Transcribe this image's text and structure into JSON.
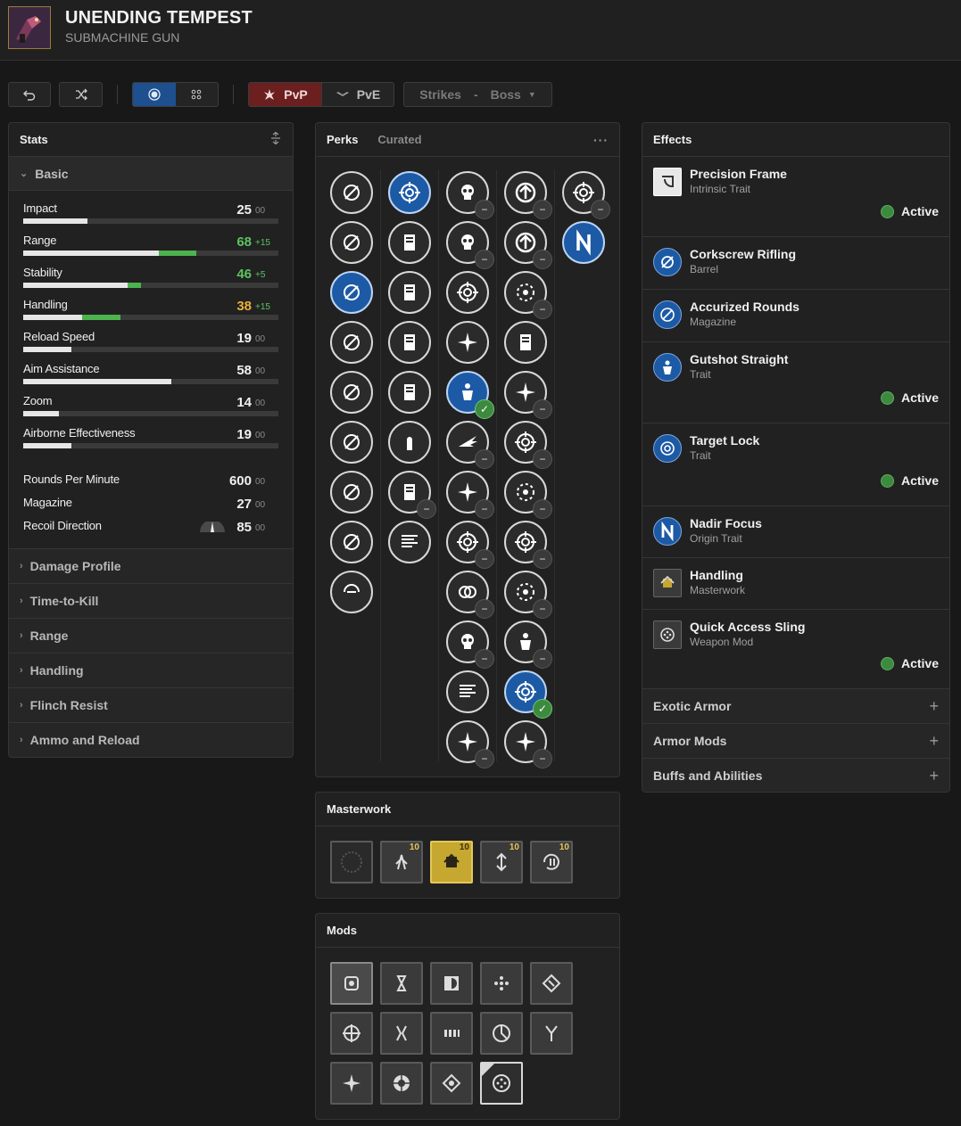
{
  "weapon": {
    "name": "UNENDING TEMPEST",
    "type": "SUBMACHINE GUN"
  },
  "toolbar": {
    "undo_icon": "undo-icon",
    "random_icon": "shuffle-icon",
    "view_single_icon": "circle-dot-icon",
    "view_grid_icon": "grid-dots-icon",
    "pvp_label": "PvP",
    "pve_label": "PvE",
    "activity": "Strikes",
    "activity_sep": "-",
    "difficulty": "Boss"
  },
  "stats": {
    "title": "Stats",
    "basic_label": "Basic",
    "rows": [
      {
        "name": "Impact",
        "value": "25",
        "bonus": "00",
        "base": 25,
        "boost": 0,
        "color": "#f0f0f0"
      },
      {
        "name": "Range",
        "value": "68",
        "bonus": "+15",
        "base": 53,
        "boost": 15,
        "color": "#5cc35f"
      },
      {
        "name": "Stability",
        "value": "46",
        "bonus": "+5",
        "base": 41,
        "boost": 5,
        "color": "#5cc35f"
      },
      {
        "name": "Handling",
        "value": "38",
        "bonus": "+15",
        "base": 23,
        "boost": 15,
        "color": "#e8b13b"
      },
      {
        "name": "Reload Speed",
        "value": "19",
        "bonus": "00",
        "base": 19,
        "boost": 0,
        "color": "#f0f0f0"
      },
      {
        "name": "Aim Assistance",
        "value": "58",
        "bonus": "00",
        "base": 58,
        "boost": 0,
        "color": "#f0f0f0"
      },
      {
        "name": "Zoom",
        "value": "14",
        "bonus": "00",
        "base": 14,
        "boost": 0,
        "color": "#f0f0f0"
      },
      {
        "name": "Airborne Effectiveness",
        "value": "19",
        "bonus": "00",
        "base": 19,
        "boost": 0,
        "color": "#f0f0f0"
      }
    ],
    "extra": [
      {
        "name": "Rounds Per Minute",
        "value": "600",
        "bonus": "00"
      },
      {
        "name": "Magazine",
        "value": "27",
        "bonus": "00"
      },
      {
        "name": "Recoil Direction",
        "value": "85",
        "bonus": "00"
      }
    ],
    "sections": [
      "Damage Profile",
      "Time-to-Kill",
      "Range",
      "Handling",
      "Flinch Resist",
      "Ammo and Reload"
    ]
  },
  "perks": {
    "tab_active": "Perks",
    "tab_inactive": "Curated",
    "more_label": "···",
    "check_symbol": "✓",
    "minus_symbol": "−"
  },
  "masterwork": {
    "title": "Masterwork",
    "tiers": [
      "10",
      "10",
      "10",
      "10"
    ]
  },
  "mods": {
    "title": "Mods"
  },
  "effects": {
    "title": "Effects",
    "active_label": "Active",
    "items": [
      {
        "name": "Precision Frame",
        "type": "Intrinsic Trait",
        "active": true
      },
      {
        "name": "Corkscrew Rifling",
        "type": "Barrel",
        "active": false
      },
      {
        "name": "Accurized Rounds",
        "type": "Magazine",
        "active": false
      },
      {
        "name": "Gutshot Straight",
        "type": "Trait",
        "active": true
      },
      {
        "name": "Target Lock",
        "type": "Trait",
        "active": true
      },
      {
        "name": "Nadir Focus",
        "type": "Origin Trait",
        "active": false
      },
      {
        "name": "Handling",
        "type": "Masterwork",
        "active": false
      },
      {
        "name": "Quick Access Sling",
        "type": "Weapon Mod",
        "active": true
      }
    ],
    "expanders": [
      "Exotic Armor",
      "Armor Mods",
      "Buffs and Abilities"
    ],
    "expander_symbol": "+"
  }
}
